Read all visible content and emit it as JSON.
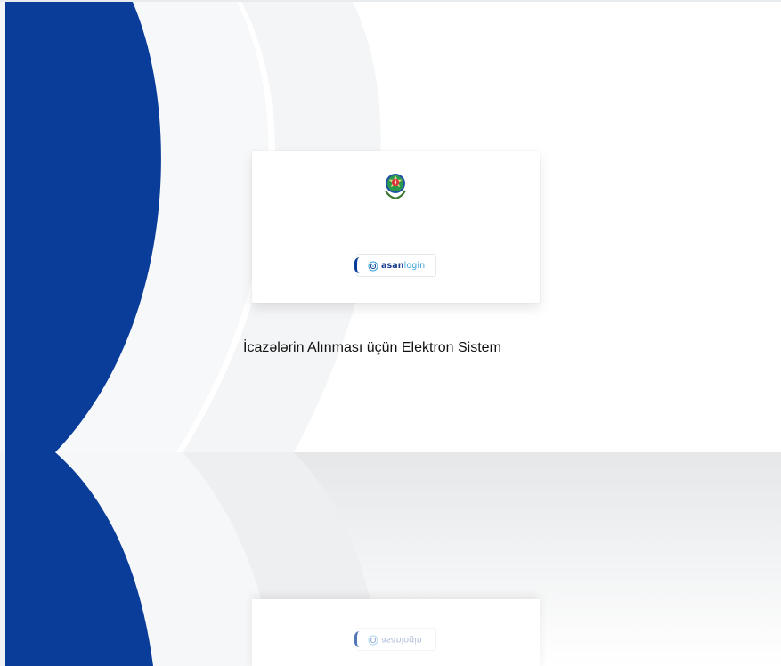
{
  "colors": {
    "brand_blue": "#0a3d99",
    "arc_light": "#f3f4f5",
    "arc_mid": "#eceef0",
    "asan_dark": "#1a3d8f",
    "asan_light": "#3aa0d8"
  },
  "card": {
    "emblem_icon": "azerbaijan-emblem-icon",
    "login_button": {
      "brand_part1": "asan",
      "brand_part2": "login",
      "icon": "asan-logo-icon"
    }
  },
  "system_title": "İcazələrin Alınması üçün Elektron Sistem"
}
